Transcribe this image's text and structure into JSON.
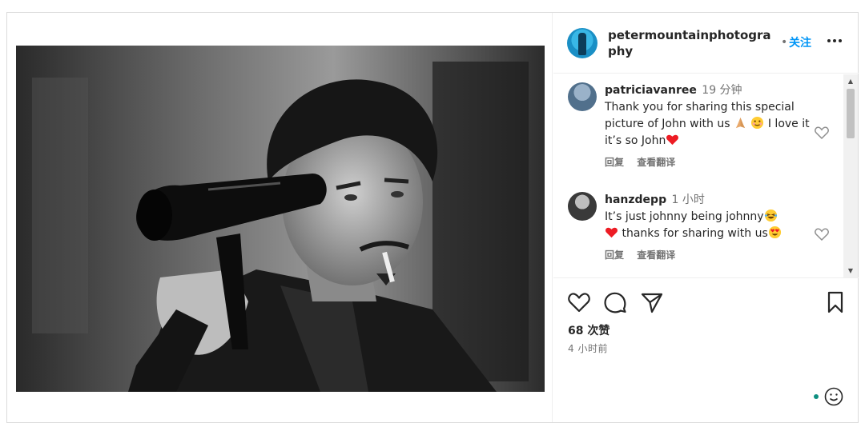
{
  "post": {
    "author": "petermountainphotography",
    "separator": "•",
    "follow_label": "关注",
    "more_label": "•••",
    "likes": "68 次赞",
    "time_ago": "4 小时前"
  },
  "comments": [
    {
      "user": "patriciavanree",
      "time": "19 分钟",
      "text_parts": [
        "Thank you for sharing this special picture of John with us ",
        " ",
        " I love it it’s so John"
      ],
      "emojis": [
        "folded-hands",
        "smiling-face",
        "red-heart"
      ],
      "reply_label": "回复",
      "translate_label": "查看翻译"
    },
    {
      "user": "hanzdepp",
      "time": "1 小时",
      "text_parts": [
        "It’s just johnny being johnny",
        "",
        " thanks for sharing with us"
      ],
      "emojis": [
        "laughing-face",
        "red-heart",
        "heart-eyes-face"
      ],
      "reply_label": "回复",
      "translate_label": "查看翻译"
    }
  ],
  "icons": {
    "like": "heart-icon",
    "comment": "comment-icon",
    "share": "send-icon",
    "save": "bookmark-icon",
    "emoji": "emoji-icon"
  },
  "colors": {
    "accent": "#0095f6",
    "heart": "#ed1c24",
    "muted": "#737373"
  }
}
